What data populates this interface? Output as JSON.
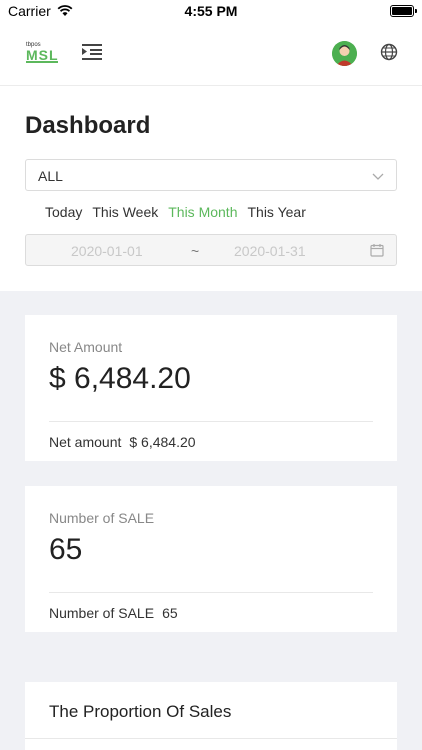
{
  "status_bar": {
    "carrier": "Carrier",
    "time": "4:55 PM"
  },
  "header": {
    "logo_small": "tbpos",
    "logo_main": "MSL",
    "brand_color": "#5cb85c"
  },
  "dashboard": {
    "title": "Dashboard",
    "store_select": {
      "value": "ALL"
    },
    "quick_ranges": [
      {
        "label": "Today",
        "active": false
      },
      {
        "label": "This Week",
        "active": false
      },
      {
        "label": "This Month",
        "active": true
      },
      {
        "label": "This Year",
        "active": false
      }
    ],
    "date_range": {
      "start": "2020-01-01",
      "separator": "~",
      "end": "2020-01-31"
    }
  },
  "net_amount_card": {
    "label": "Net Amount",
    "value": "$ 6,484.20",
    "footer_label": "Net amount",
    "footer_value": "$ 6,484.20"
  },
  "sale_count_card": {
    "label": "Number of SALE",
    "value": "65",
    "footer_label": "Number of SALE",
    "footer_value": "65"
  },
  "proportion_card": {
    "title": "The Proportion Of Sales"
  }
}
